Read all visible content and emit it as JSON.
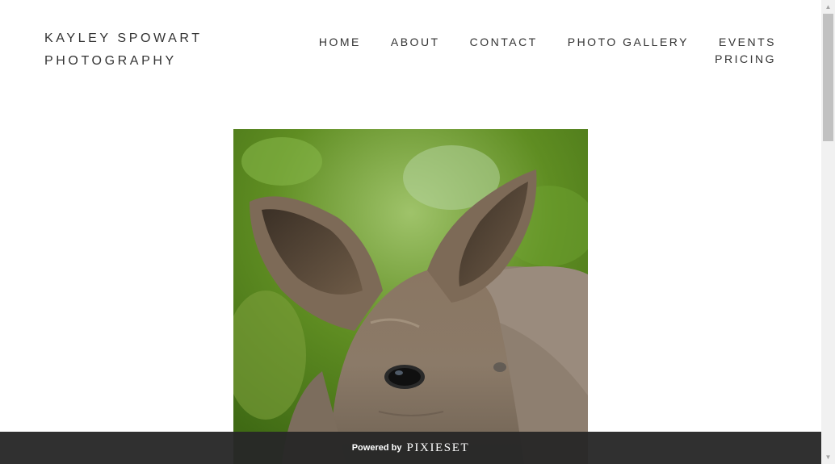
{
  "brand": {
    "line1": "KAYLEY SPOWART",
    "line2": "PHOTOGRAPHY"
  },
  "nav": {
    "items": [
      {
        "label": "HOME"
      },
      {
        "label": "ABOUT"
      },
      {
        "label": "CONTACT"
      },
      {
        "label": "PHOTO GALLERY"
      },
      {
        "label": "EVENTS"
      },
      {
        "label": "PRICING"
      }
    ]
  },
  "hero_image": {
    "subject": "kangaroo close-up"
  },
  "footer": {
    "powered_label": "Powered by",
    "logo_text": "PIXIESET"
  },
  "colors": {
    "text": "#333333",
    "footer_bg": "#282828",
    "background": "#ffffff"
  }
}
